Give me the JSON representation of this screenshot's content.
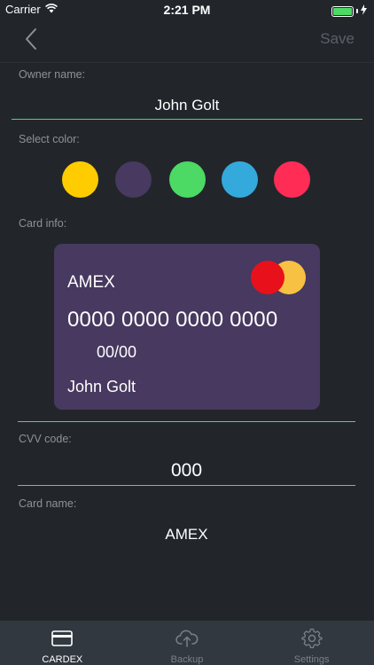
{
  "status_bar": {
    "carrier": "Carrier",
    "time": "2:21 PM"
  },
  "nav": {
    "save_label": "Save"
  },
  "owner": {
    "label": "Owner name:",
    "value": "John Golt"
  },
  "colors": {
    "label": "Select color:",
    "swatches": [
      "#ffcc00",
      "#47395f",
      "#4cd964",
      "#34aadc",
      "#ff2d55"
    ]
  },
  "card": {
    "label": "Card info:",
    "brand": "AMEX",
    "number": "0000 0000 0000 0000",
    "expiry": "00/00",
    "holder": "John Golt",
    "background": "#47395f"
  },
  "cvv": {
    "label": "CVV code:",
    "value": "000"
  },
  "card_name": {
    "label": "Card name:",
    "value": "AMEX"
  },
  "tabs": [
    {
      "label": "CARDEX",
      "icon": "card-icon",
      "active": true
    },
    {
      "label": "Backup",
      "icon": "cloud-upload-icon",
      "active": false
    },
    {
      "label": "Settings",
      "icon": "gear-icon",
      "active": false
    }
  ],
  "accent": "#4cd964"
}
